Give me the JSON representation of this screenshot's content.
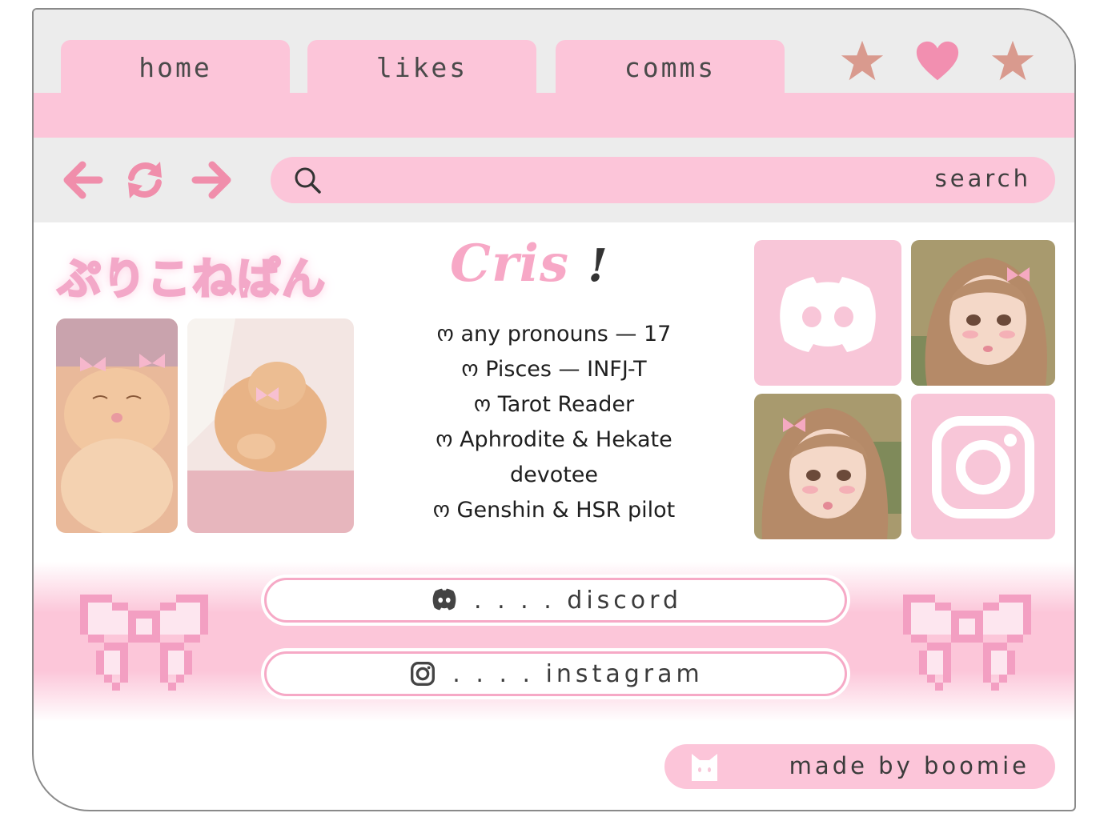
{
  "tabs": [
    {
      "label": "home"
    },
    {
      "label": "likes"
    },
    {
      "label": "comms"
    }
  ],
  "tab_icons": [
    "star-icon",
    "heart-icon",
    "star-icon"
  ],
  "nav": {
    "back_icon": "arrow-left-icon",
    "reload_icon": "reload-icon",
    "forward_icon": "arrow-right-icon"
  },
  "search": {
    "label": "search"
  },
  "profile": {
    "logo_text": "ぷりこねぱん",
    "name": "Cris",
    "name_mark": "!",
    "bio": [
      "ო any pronouns — 17",
      "ო Pisces — INFJ-T",
      "ო Tarot Reader",
      "ო Aphrodite & Hekate",
      "devotee",
      "ო Genshin & HSR pilot"
    ]
  },
  "links": {
    "discord": ". . . . discord",
    "instagram": ". . . . instagram"
  },
  "footer": {
    "credit": "made by boomie"
  },
  "colors": {
    "pink": "#fcc5d9",
    "gray": "#ececec",
    "accent_brown": "#d99a8e",
    "heart": "#f28fb0",
    "nav_icon": "#f08eab"
  }
}
